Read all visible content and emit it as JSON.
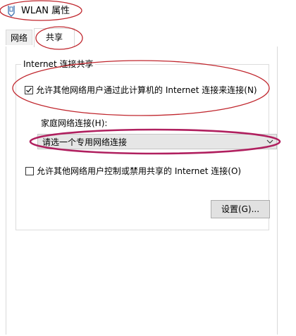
{
  "window": {
    "title": "WLAN 属性",
    "icon": "network-adapter-icon"
  },
  "tabs": [
    {
      "label": "网络",
      "selected": false
    },
    {
      "label": "共享",
      "selected": true
    }
  ],
  "sharing": {
    "group_title": "Internet 连接共享",
    "allow_connect": {
      "label": "允许其他网络用户通过此计算机的 Internet 连接来连接(N)",
      "checked": true
    },
    "home_network_label": "家庭网络连接(H):",
    "home_network_select": {
      "value": "请选一个专用网络连接"
    },
    "allow_control": {
      "label": "允许其他网络用户控制或禁用共享的 Internet 连接(O)",
      "checked": false
    },
    "settings_button": "设置(G)..."
  },
  "annotation_colors": {
    "red": "#c0262d",
    "magenta": "#b0205f"
  }
}
